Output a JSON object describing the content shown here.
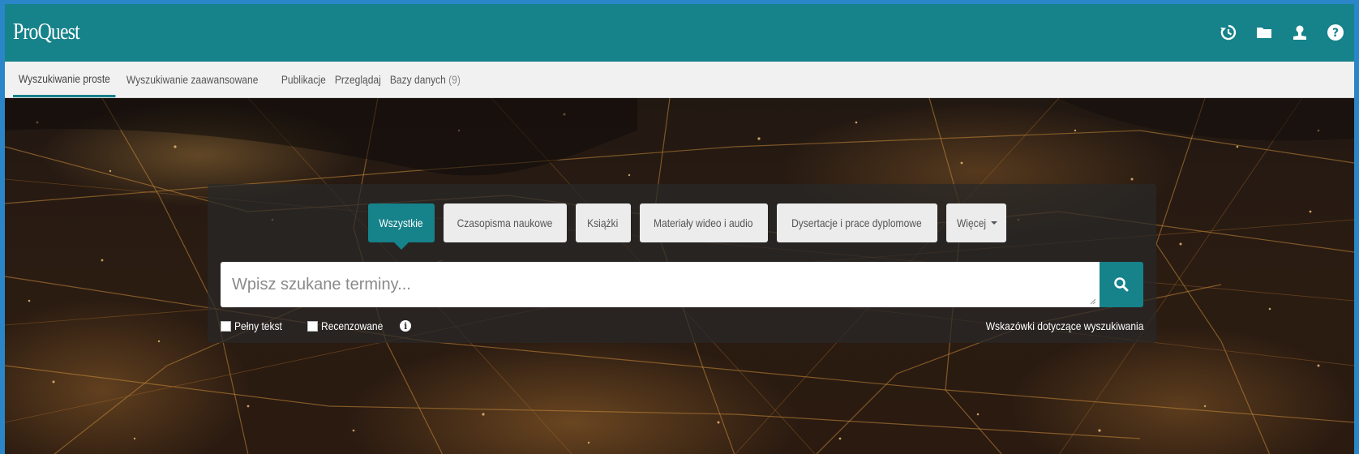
{
  "header": {
    "logo": "ProQuest",
    "icons": [
      "history-icon",
      "folder-icon",
      "user-icon",
      "help-icon"
    ]
  },
  "nav": {
    "items": [
      {
        "label": "Wyszukiwanie proste",
        "active": true
      },
      {
        "label": "Wyszukiwanie zaawansowane"
      },
      {
        "label": "Publikacje"
      },
      {
        "label": "Przeglądaj"
      },
      {
        "label": "Bazy danych",
        "count": "(9)"
      }
    ]
  },
  "search": {
    "tabs": [
      {
        "label": "Wszystkie",
        "active": true
      },
      {
        "label": "Czasopisma naukowe"
      },
      {
        "label": "Książki"
      },
      {
        "label": "Materiały wideo i audio"
      },
      {
        "label": "Dysertacje i prace dyplomowe"
      },
      {
        "label": "Więcej"
      }
    ],
    "placeholder": "Wpisz szukane terminy...",
    "value": "",
    "full_text_label": "Pełny tekst",
    "full_text_checked": false,
    "peer_reviewed_label": "Recenzowane",
    "peer_reviewed_checked": false,
    "tips_link": "Wskazówki dotyczące wyszukiwania"
  },
  "colors": {
    "brand": "#16828a",
    "nav_bg": "#f1f1f1",
    "outer_border": "#2a86c8"
  }
}
